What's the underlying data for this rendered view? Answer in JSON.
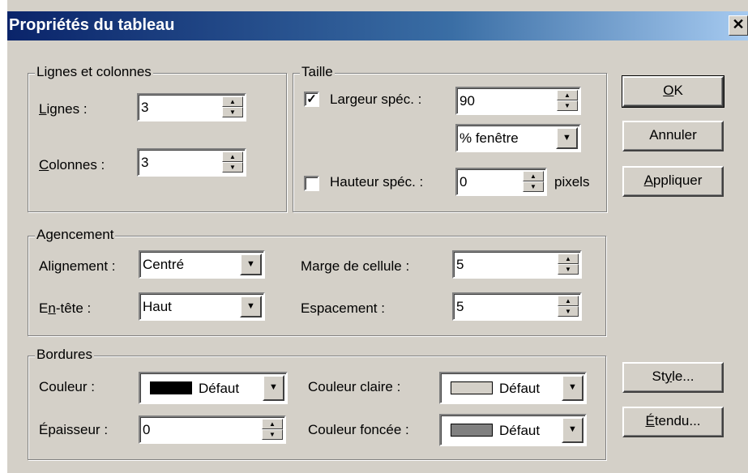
{
  "window": {
    "title": "Propriétés du tableau",
    "close_glyph": "✕"
  },
  "groups": {
    "lines_columns": {
      "legend": "Lignes et colonnes",
      "rows_label_pre": "",
      "rows_label_key": "L",
      "rows_label_post": "ignes :",
      "rows_value": "3",
      "cols_label_pre": "",
      "cols_label_key": "C",
      "cols_label_post": "olonnes :",
      "cols_value": "3"
    },
    "size": {
      "legend": "Taille",
      "width_checked": true,
      "width_label": "Largeur spéc. :",
      "width_value": "90",
      "width_unit": "% fenêtre",
      "height_checked": false,
      "height_label": "Hauteur spéc. :",
      "height_value": "0",
      "height_unit": "pixels"
    },
    "layout": {
      "legend": "Agencement",
      "align_label": "Alignement :",
      "align_value": "Centré",
      "header_label_pre": "E",
      "header_label_key": "n",
      "header_label_post": "-tête :",
      "header_value": "Haut",
      "padding_label": "Marge de cellule :",
      "padding_value": "5",
      "spacing_label": "Espacement :",
      "spacing_value": "5"
    },
    "borders": {
      "legend": "Bordures",
      "color_label": "Couleur :",
      "color_value": "Défaut",
      "color_swatch": "#000000",
      "thickness_label": "Épaisseur :",
      "thickness_value": "0",
      "light_label": "Couleur claire :",
      "light_value": "Défaut",
      "light_swatch": "#d4d0c8",
      "dark_label": "Couleur foncée :",
      "dark_value": "Défaut",
      "dark_swatch": "#808080"
    }
  },
  "buttons": {
    "ok_key": "O",
    "ok_rest": "K",
    "cancel": "Annuler",
    "apply_key": "A",
    "apply_rest": "ppliquer",
    "style_pre": "St",
    "style_key": "y",
    "style_post": "le...",
    "ext_key": "É",
    "ext_rest": "tendu..."
  },
  "glyphs": {
    "up": "▲",
    "down": "▼",
    "check": "✓"
  }
}
